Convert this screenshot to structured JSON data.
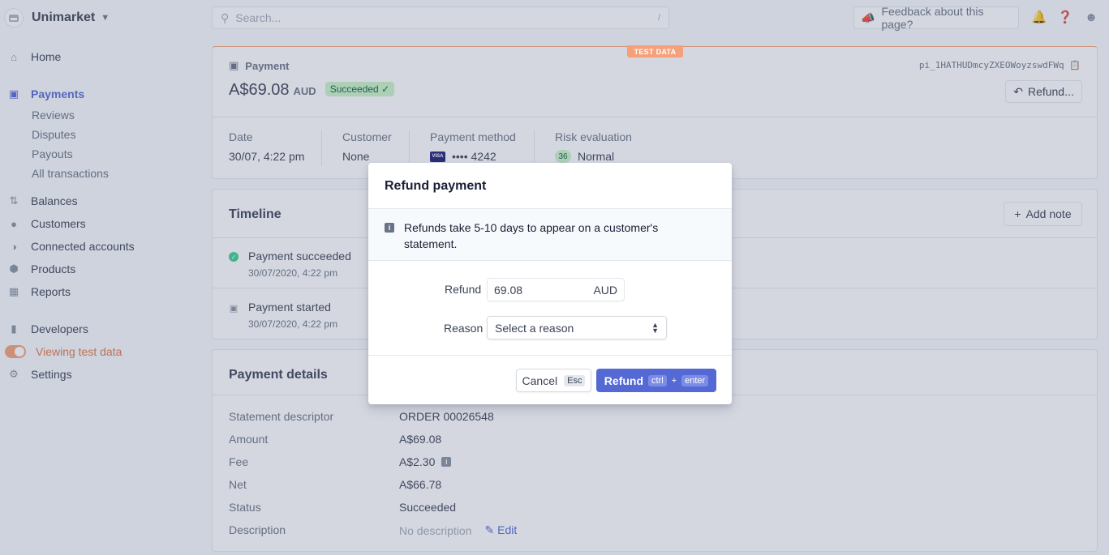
{
  "brand": {
    "name": "Unimarket"
  },
  "sidebar": {
    "items": [
      {
        "label": "Home",
        "icon": "home-icon"
      },
      {
        "label": "Payments",
        "icon": "payments-icon",
        "active": true
      },
      {
        "label": "Balances",
        "icon": "balances-icon"
      },
      {
        "label": "Customers",
        "icon": "customers-icon"
      },
      {
        "label": "Connected accounts",
        "icon": "connected-accounts-icon"
      },
      {
        "label": "Products",
        "icon": "products-icon"
      },
      {
        "label": "Reports",
        "icon": "reports-icon"
      },
      {
        "label": "Developers",
        "icon": "developers-icon"
      },
      {
        "label": "Viewing test data",
        "icon": "toggle-icon"
      },
      {
        "label": "Settings",
        "icon": "gear-icon"
      }
    ],
    "payments_sub": [
      "Reviews",
      "Disputes",
      "Payouts",
      "All transactions"
    ]
  },
  "topbar": {
    "search_placeholder": "Search...",
    "search_shortcut": "/",
    "feedback": "Feedback about this page?"
  },
  "payment": {
    "test_badge": "TEST DATA",
    "label": "Payment",
    "amount": "A$69.08",
    "currency": "AUD",
    "status": "Succeeded",
    "id": "pi_1HATHUDmcyZXEOWoyzswdFWq",
    "refund_button": "Refund...",
    "facts": [
      {
        "label": "Date",
        "value": "30/07, 4:22 pm"
      },
      {
        "label": "Customer",
        "value": "None"
      },
      {
        "label": "Payment method",
        "value": "•••• 4242",
        "badge": "VISA"
      },
      {
        "label": "Risk evaluation",
        "value": "Normal",
        "badge": "36"
      }
    ]
  },
  "timeline": {
    "title": "Timeline",
    "add_note": "Add note",
    "events": [
      {
        "title": "Payment succeeded",
        "date": "30/07/2020, 4:22 pm"
      },
      {
        "title": "Payment started",
        "date": "30/07/2020, 4:22 pm"
      }
    ]
  },
  "details": {
    "title": "Payment details",
    "rows": [
      {
        "key": "Statement descriptor",
        "value": "ORDER 00026548"
      },
      {
        "key": "Amount",
        "value": "A$69.08"
      },
      {
        "key": "Fee",
        "value": "A$2.30"
      },
      {
        "key": "Net",
        "value": "A$66.78"
      },
      {
        "key": "Status",
        "value": "Succeeded"
      },
      {
        "key": "Description",
        "value": "No description"
      }
    ],
    "edit_label": "Edit"
  },
  "modal": {
    "title": "Refund payment",
    "notice": "Refunds take 5-10 days to appear on a customer's statement.",
    "refund_label": "Refund",
    "refund_value": "69.08",
    "refund_currency": "AUD",
    "reason_label": "Reason",
    "reason_selected": "Select a reason",
    "cancel_label": "Cancel",
    "cancel_key": "Esc",
    "submit_label": "Refund",
    "submit_key1": "ctrl",
    "submit_plus": "+",
    "submit_key2": "enter"
  }
}
